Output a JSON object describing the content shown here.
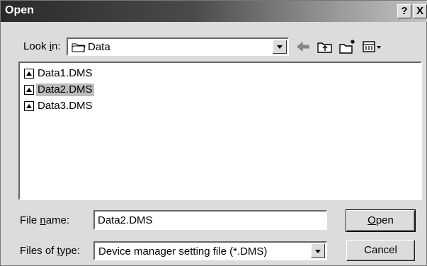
{
  "window": {
    "title": "Open",
    "help_label": "?",
    "close_label": "X"
  },
  "look_in": {
    "label_pre": "Look ",
    "label_key": "i",
    "label_post": "n:",
    "value": "Data"
  },
  "toolbar": {
    "icons": [
      "back-arrow-icon",
      "up-one-level-icon",
      "create-new-folder-icon",
      "view-menu-icon"
    ]
  },
  "files": [
    {
      "name": "Data1.DMS",
      "selected": false
    },
    {
      "name": "Data2.DMS",
      "selected": true
    },
    {
      "name": "Data3.DMS",
      "selected": false
    }
  ],
  "file_name": {
    "label_pre": "File ",
    "label_key": "n",
    "label_post": "ame:",
    "value": "Data2.DMS"
  },
  "file_type": {
    "label_pre": "Files of ",
    "label_key": "t",
    "label_post": "ype:",
    "value": "Device manager setting file (*.DMS)"
  },
  "buttons": {
    "open_key": "O",
    "open_rest": "pen",
    "cancel": "Cancel"
  }
}
